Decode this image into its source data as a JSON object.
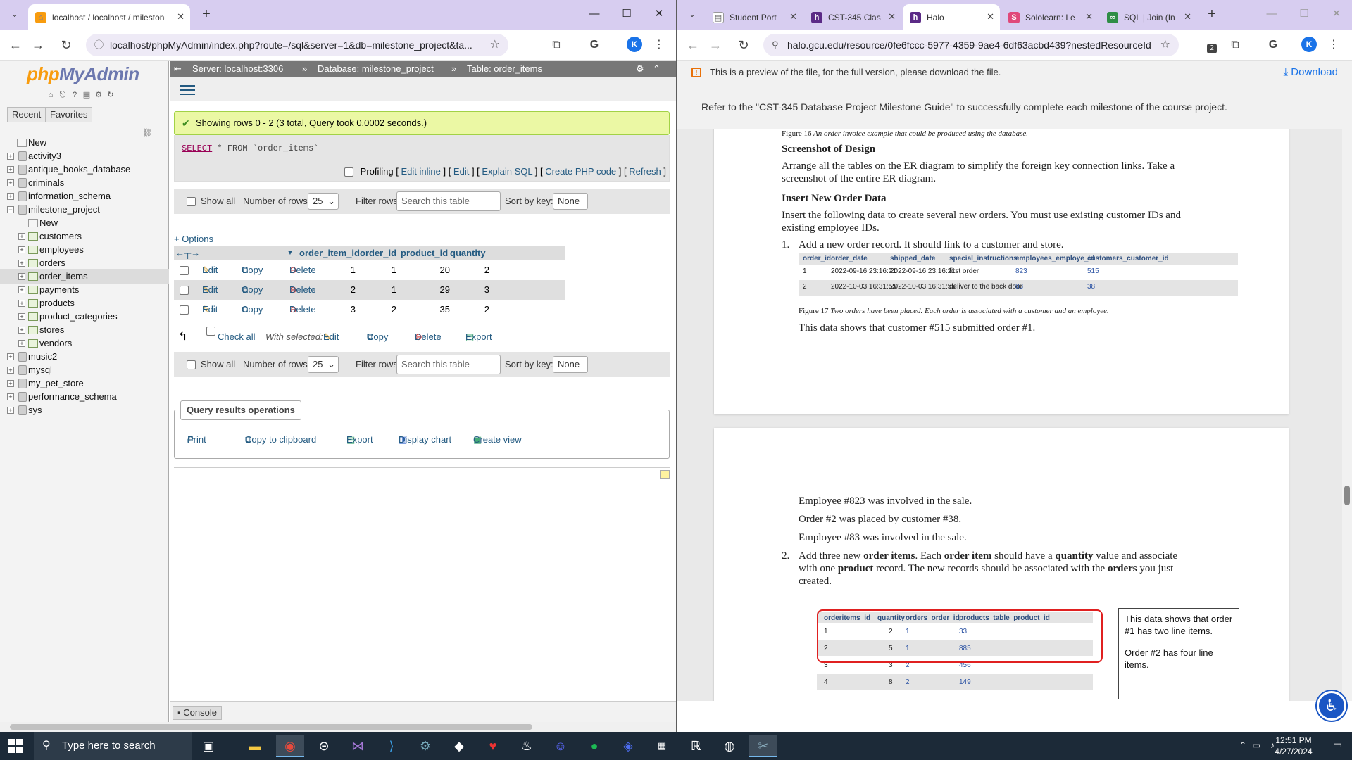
{
  "left_browser": {
    "tabs": [
      {
        "title": "localhost / localhost / milestone",
        "active": true
      }
    ],
    "url": "localhost/phpMyAdmin/index.php?route=/sql&server=1&db=milestone_project&ta...",
    "avatar": "K"
  },
  "pma": {
    "logo_php": "php",
    "logo_myadmin": "MyAdmin",
    "nav_tabs": [
      "Recent",
      "Favorites"
    ],
    "tree": [
      {
        "label": "New",
        "level": 0,
        "kind": "new"
      },
      {
        "label": "activity3",
        "level": 0,
        "kind": "db"
      },
      {
        "label": "antique_books_database",
        "level": 0,
        "kind": "db"
      },
      {
        "label": "criminals",
        "level": 0,
        "kind": "db"
      },
      {
        "label": "information_schema",
        "level": 0,
        "kind": "db"
      },
      {
        "label": "milestone_project",
        "level": 0,
        "kind": "db-open"
      },
      {
        "label": "New",
        "level": 1,
        "kind": "new"
      },
      {
        "label": "customers",
        "level": 1,
        "kind": "table"
      },
      {
        "label": "employees",
        "level": 1,
        "kind": "table"
      },
      {
        "label": "orders",
        "level": 1,
        "kind": "table"
      },
      {
        "label": "order_items",
        "level": 1,
        "kind": "table",
        "selected": true
      },
      {
        "label": "payments",
        "level": 1,
        "kind": "table"
      },
      {
        "label": "products",
        "level": 1,
        "kind": "table"
      },
      {
        "label": "product_categories",
        "level": 1,
        "kind": "table"
      },
      {
        "label": "stores",
        "level": 1,
        "kind": "table"
      },
      {
        "label": "vendors",
        "level": 1,
        "kind": "table"
      },
      {
        "label": "music2",
        "level": 0,
        "kind": "db"
      },
      {
        "label": "mysql",
        "level": 0,
        "kind": "db"
      },
      {
        "label": "my_pet_store",
        "level": 0,
        "kind": "db"
      },
      {
        "label": "performance_schema",
        "level": 0,
        "kind": "db"
      },
      {
        "label": "sys",
        "level": 0,
        "kind": "db"
      }
    ],
    "breadcrumb": {
      "server": "Server: localhost:3306",
      "database": "Database: milestone_project",
      "table": "Table: order_items",
      "sep": "»"
    },
    "success": "Showing rows 0 - 2 (3 total, Query took 0.0002 seconds.)",
    "sql": {
      "kw1": "SELECT",
      "rest": " * FROM `order_items`"
    },
    "profiling": {
      "label": "Profiling",
      "links": [
        "Edit inline",
        "Edit",
        "Explain SQL",
        "Create PHP code",
        "Refresh"
      ]
    },
    "nav_controls": {
      "show_all": "Show all",
      "num_rows_label": "Number of rows:",
      "num_rows_value": "25",
      "filter_label": "Filter rows:",
      "filter_placeholder": "Search this table",
      "sort_label": "Sort by key:",
      "sort_value": "None"
    },
    "options_link": "+ Options",
    "columns": [
      "order_item_id",
      "order_id",
      "product_id",
      "quantity"
    ],
    "rows": [
      {
        "order_item_id": "1",
        "order_id": "1",
        "product_id": "20",
        "quantity": "2"
      },
      {
        "order_item_id": "2",
        "order_id": "1",
        "product_id": "29",
        "quantity": "3"
      },
      {
        "order_item_id": "3",
        "order_id": "2",
        "product_id": "35",
        "quantity": "2"
      }
    ],
    "row_actions": {
      "edit": "Edit",
      "copy": "Copy",
      "delete": "Delete"
    },
    "bulk": {
      "check_all": "Check all",
      "with_selected": "With selected:",
      "edit": "Edit",
      "copy": "Copy",
      "delete": "Delete",
      "export": "Export"
    },
    "qro": {
      "title": "Query results operations",
      "items": [
        "Print",
        "Copy to clipboard",
        "Export",
        "Display chart",
        "Create view"
      ]
    },
    "console": "Console"
  },
  "right_browser": {
    "tabs": [
      {
        "title": "Student Port",
        "active": false
      },
      {
        "title": "CST-345 Clas",
        "active": false
      },
      {
        "title": "Halo",
        "active": true
      },
      {
        "title": "Sololearn: Le",
        "active": false
      },
      {
        "title": "SQL | Join (In",
        "active": false
      }
    ],
    "url": "halo.gcu.edu/resource/0fe6fccc-5977-4359-9ae4-6df63acbd439?nestedResourceId=...",
    "ext_badge": "2",
    "avatar": "K"
  },
  "halo": {
    "banner": "This is a preview of the file, for the full version, please download the file.",
    "download": "Download",
    "guide": "Refer to the \"CST-345 Database Project Milestone Guide\" to successfully complete each milestone of the course project."
  },
  "doc": {
    "fig16_label": "Figure 16",
    "fig16_caption": "An order invoice example that could be produced using the database.",
    "h_design": "Screenshot of Design",
    "p_design_1": "Arrange all the tables on the ER diagram to simplify the foreign key connection links. Take a",
    "p_design_2": "screenshot of the entire ER diagram.",
    "h_insert": "Insert New Order Data",
    "p_insert_1": "Insert the following data to create several new orders. You must use existing customer IDs and",
    "p_insert_2": "existing employee IDs.",
    "item1_num": "1.",
    "item1": "Add a new order record. It should link to a customer and store.",
    "orders_table": {
      "headers": [
        "order_id",
        "order_date",
        "shipped_date",
        "special_instructions",
        "employees_employe_id",
        "customers_customer_id"
      ],
      "rows": [
        [
          "1",
          "2022-09-16 23:16:21",
          "2022-09-16 23:16:21",
          "first order",
          "823",
          "515"
        ],
        [
          "2",
          "2022-10-03 16:31:55",
          "2022-10-03 16:31:55",
          "deliver to the back door",
          "83",
          "38"
        ]
      ]
    },
    "fig17_label": "Figure 17",
    "fig17_caption": "Two orders have been placed. Each order is associated with a customer and an employee.",
    "p_cust515": "This data shows that customer #515 submitted order #1.",
    "p_emp823": "Employee #823 was involved in the sale.",
    "p_order2": "Order #2 was placed by customer #38.",
    "p_emp83": "Employee #83 was involved in the sale.",
    "item2_num": "2.",
    "item2": {
      "t1": "Add three new ",
      "b1": "order items",
      "t2": ". Each ",
      "b2": "order item",
      "t3": " should have a ",
      "b3": "quantity",
      "t4": " value and associate",
      "t5": "with one ",
      "b4": "product",
      "t6": " record. The new records should be associated with the ",
      "b5": "orders",
      "t7": " you just",
      "t8": "created."
    },
    "items_table": {
      "headers": [
        "orderitems_id",
        "quantity",
        "orders_order_id",
        "products_table_product_id"
      ],
      "rows": [
        [
          "1",
          "2",
          "1",
          "33"
        ],
        [
          "2",
          "5",
          "1",
          "885"
        ],
        [
          "3",
          "3",
          "2",
          "456"
        ],
        [
          "4",
          "8",
          "2",
          "149"
        ]
      ]
    },
    "note_1": "This data shows that order #1 has two line items.",
    "note_2": "Order #2 has four line items."
  },
  "taskbar": {
    "search": "Type here to search",
    "time": "12:51 PM",
    "date": "4/27/2024"
  },
  "colors": {
    "tab_strip": "#d7cdf0",
    "pma_link": "#235a81",
    "success_bg": "#ebf8a4",
    "taskbar": "#1c2a38"
  }
}
